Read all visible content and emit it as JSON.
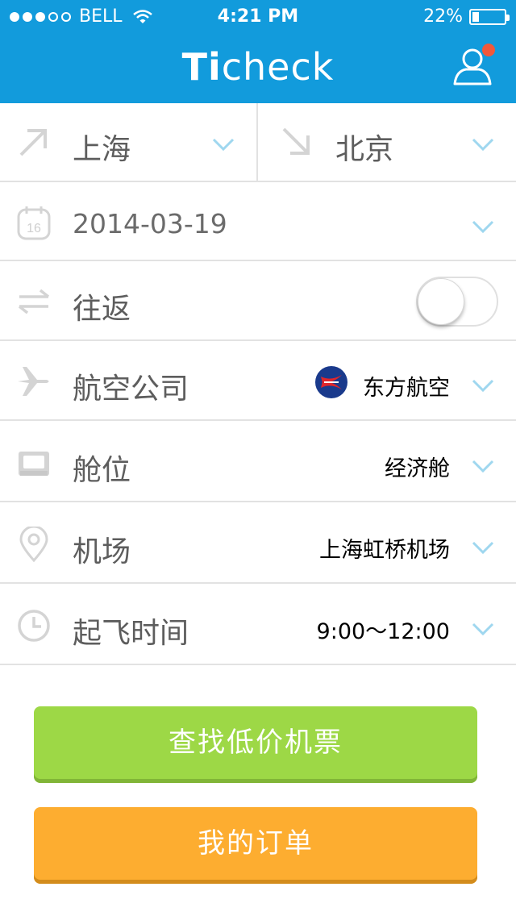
{
  "status_bar": {
    "signal_filled": 3,
    "signal_total": 5,
    "carrier": "BELL",
    "time": "4:21 PM",
    "battery_text": "22%",
    "battery_level": 0.22
  },
  "header": {
    "brand_bold": "Ti",
    "brand_rest": "check",
    "background": "#129bdc",
    "notification_color": "#f0583a"
  },
  "route": {
    "origin": "上海",
    "destination": "北京"
  },
  "date": {
    "value": "2014-03-19",
    "calendar_day": "16"
  },
  "round_trip": {
    "label": "往返",
    "enabled": false
  },
  "airline": {
    "label": "航空公司",
    "value": "东方航空"
  },
  "cabin": {
    "label": "舱位",
    "value": "经济舱"
  },
  "airport": {
    "label": "机场",
    "value": "上海虹桥机场"
  },
  "departure_time": {
    "label": "起飞时间",
    "value": "9:00～12:00"
  },
  "buttons": {
    "search": "查找低价机票",
    "search_color": "#9dd846",
    "orders": "我的订单",
    "orders_color": "#fdad30"
  },
  "icons": {
    "chevron": "chevron-down-icon",
    "user": "user-icon",
    "wifi": "wifi-icon",
    "battery": "battery-icon",
    "depart": "arrow-up-right-icon",
    "arrive": "arrow-down-right-icon",
    "calendar": "calendar-icon",
    "swap": "swap-arrows-icon",
    "plane": "plane-icon",
    "seat": "seat-icon",
    "location": "location-pin-icon",
    "clock": "clock-icon",
    "airline_logo": "china-eastern-logo"
  },
  "chevron_color": "#9fd7ef"
}
